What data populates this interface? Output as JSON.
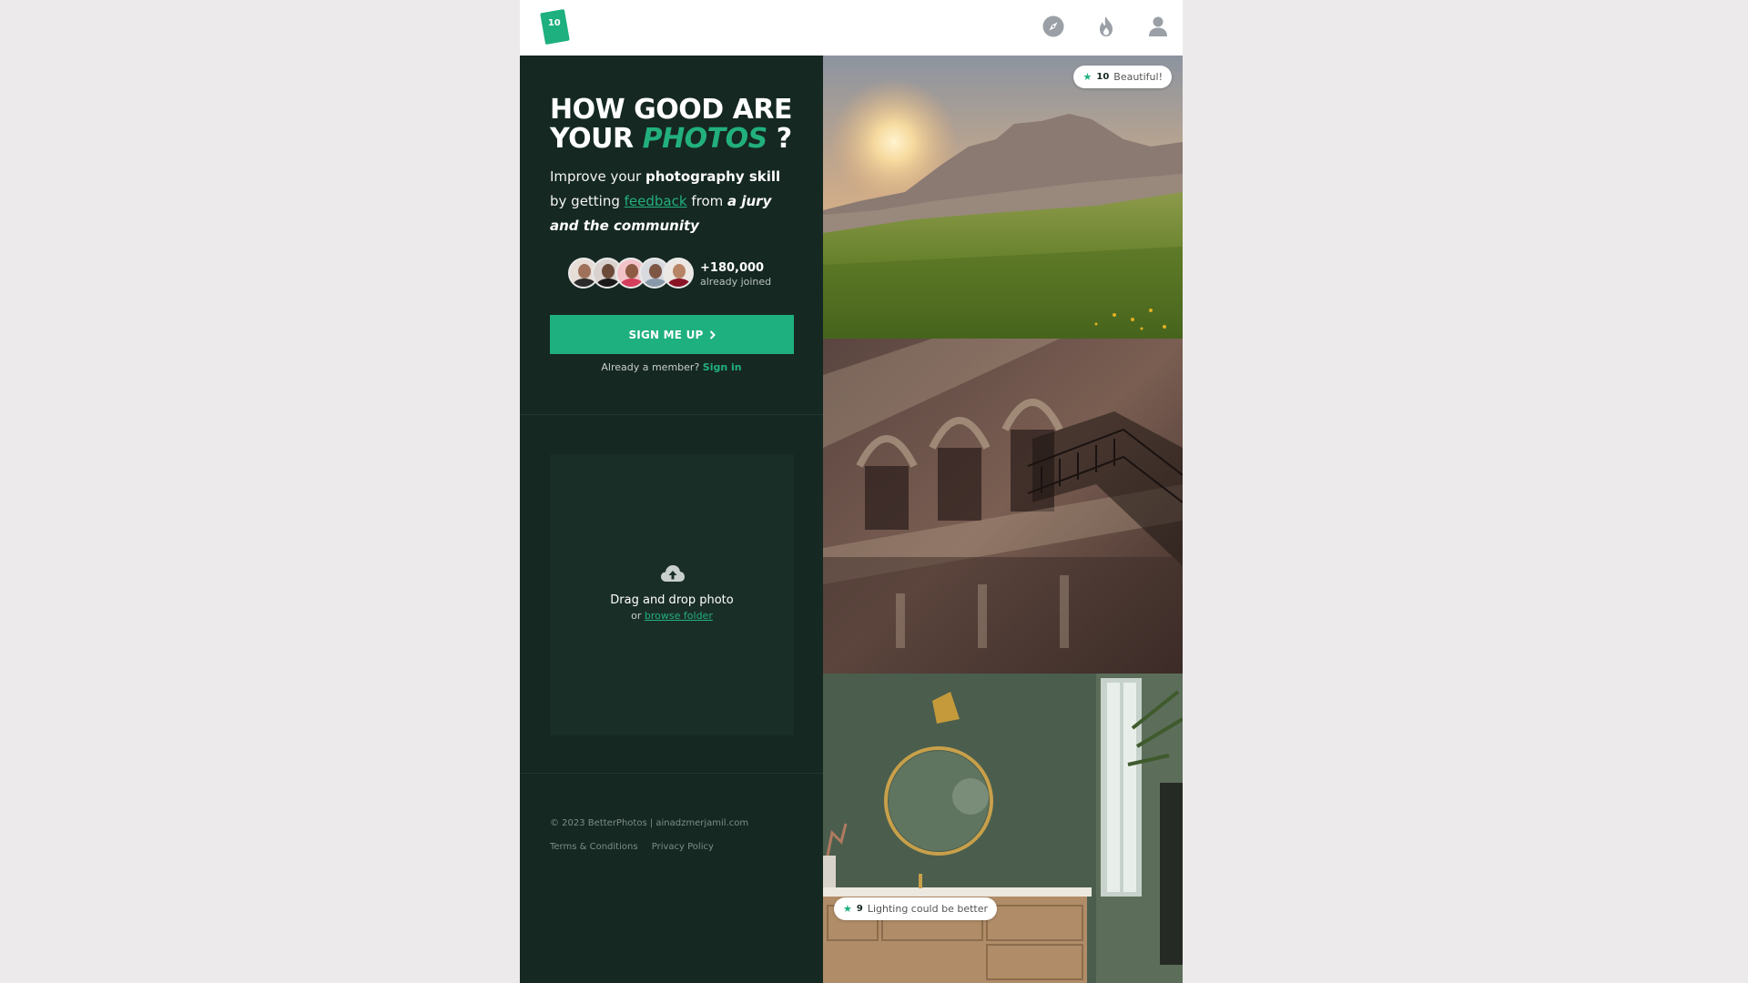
{
  "header": {
    "logo_text": "10",
    "icons": [
      "compass-icon",
      "fire-icon",
      "user-icon"
    ]
  },
  "hero": {
    "title_line1": "HOW GOOD ARE",
    "title_line2_prefix": "YOUR",
    "title_accent": "PHOTOS",
    "title_suffix": "?",
    "sub_1": "Improve your ",
    "sub_bold": "photography skill",
    "sub_2": " by getting ",
    "sub_link": "feedback",
    "sub_3": " from ",
    "sub_italic": "a jury and the community"
  },
  "social_proof": {
    "count": "+180,000",
    "label": "already joined"
  },
  "cta": {
    "signup_label": "SIGN ME UP",
    "member_prompt": "Already a member?",
    "signin_label": "Sign in"
  },
  "upload": {
    "title": "Drag and drop photo",
    "or": "or",
    "browse": "browse folder"
  },
  "footer": {
    "copyright": "© 2023 BetterPhotos | ainadzmerjamil.com",
    "terms": "Terms & Conditions",
    "privacy": "Privacy Policy"
  },
  "photos": [
    {
      "badge_score": "10",
      "badge_text": "Beautiful!"
    },
    {
      "badge_score": "",
      "badge_text": ""
    },
    {
      "badge_score": "9",
      "badge_text": "Lighting could be better"
    }
  ],
  "colors": {
    "accent": "#1eb07e",
    "panel": "#152822",
    "page_bg": "#eceaeb"
  }
}
